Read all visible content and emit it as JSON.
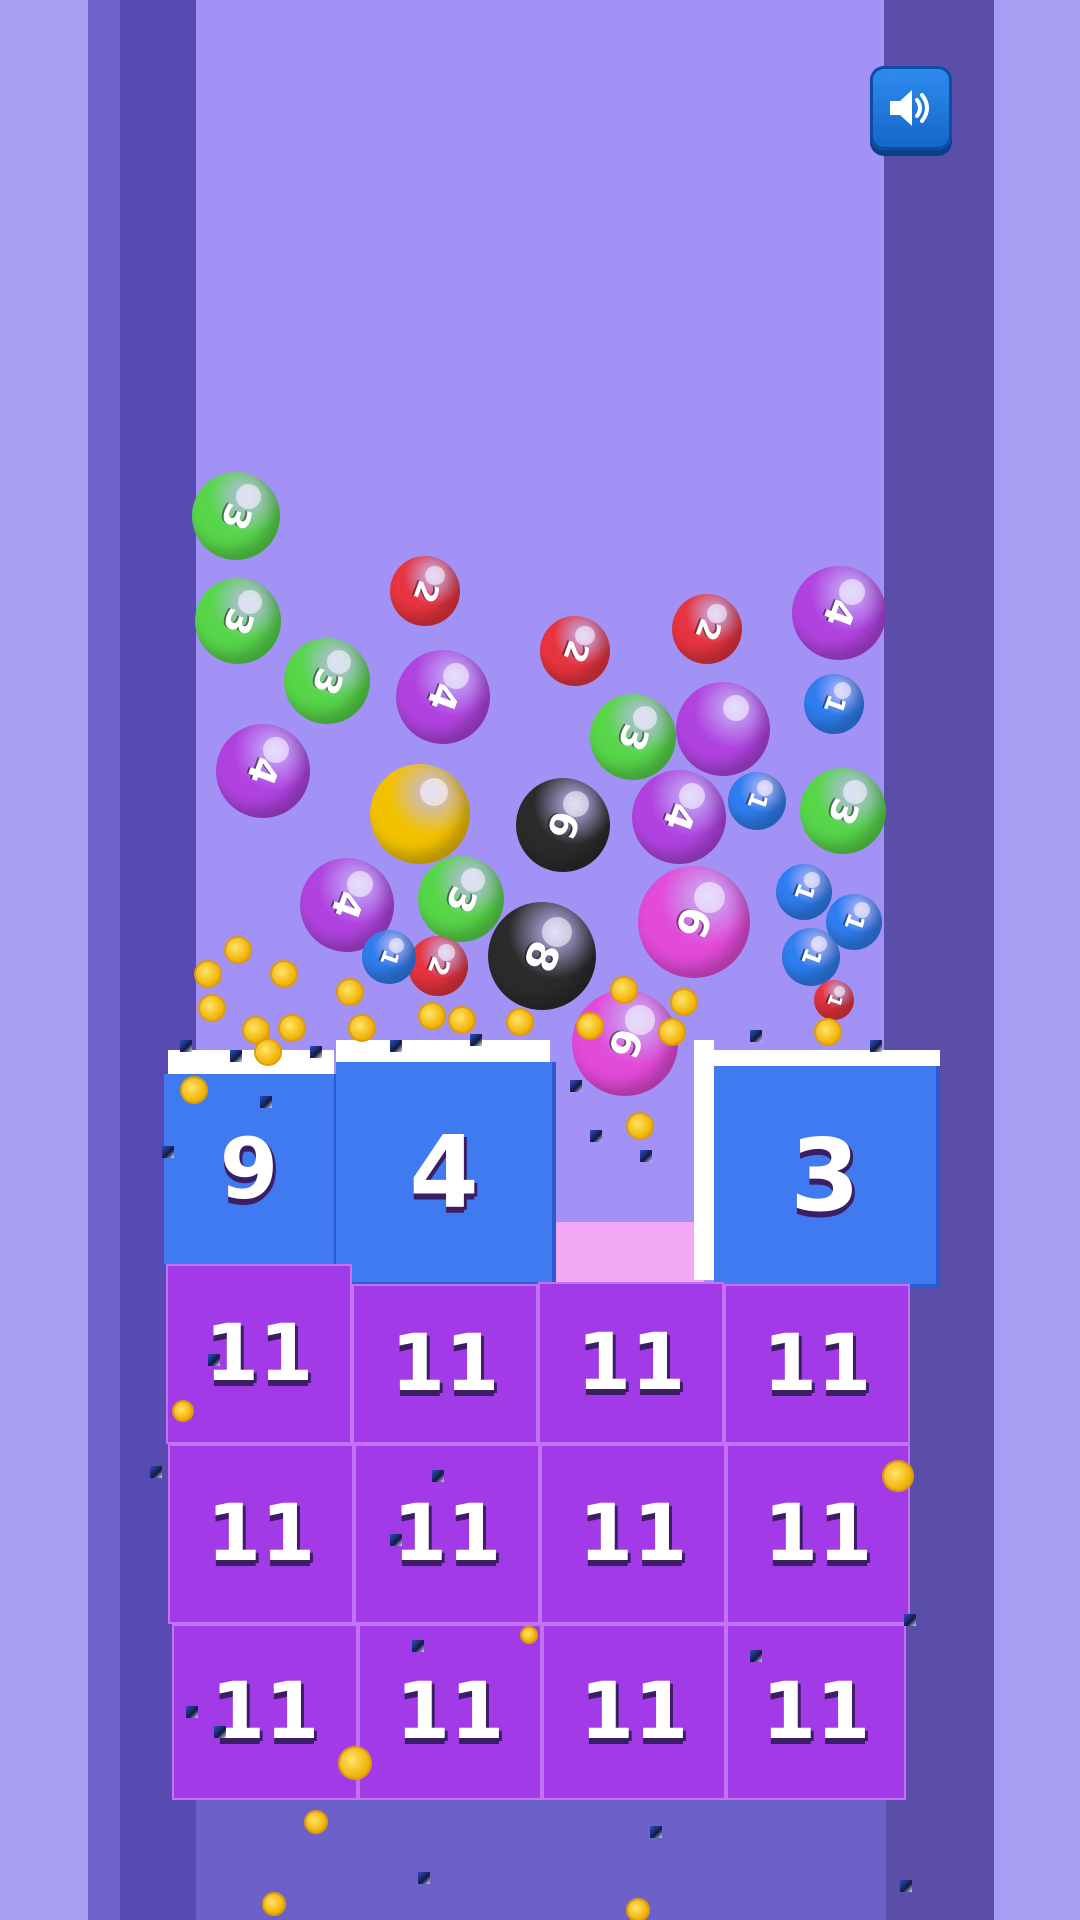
{
  "sound_button": {
    "icon": "speaker-icon",
    "color": "#1e74de"
  },
  "balls": [
    {
      "label": "3",
      "color": "#57d64a"
    },
    {
      "label": "3",
      "color": "#57d64a"
    },
    {
      "label": "3",
      "color": "#57d64a"
    },
    {
      "label": "2",
      "color": "#e8343f"
    },
    {
      "label": "2",
      "color": "#e8343f"
    },
    {
      "label": "2",
      "color": "#e8343f"
    },
    {
      "label": "4",
      "color": "#b043e0"
    },
    {
      "label": "4",
      "color": "#b043e0"
    },
    {
      "label": "4",
      "color": "#b043e0"
    },
    {
      "label": "",
      "color": "#b043e0"
    },
    {
      "label": "4",
      "color": "#b043e0"
    },
    {
      "label": "4",
      "color": "#b043e0"
    },
    {
      "label": "3",
      "color": "#57d64a"
    },
    {
      "label": "3",
      "color": "#57d64a"
    },
    {
      "label": "3",
      "color": "#57d64a"
    },
    {
      "label": "1",
      "color": "#2f7ef0"
    },
    {
      "label": "1",
      "color": "#2f7ef0"
    },
    {
      "label": "",
      "color": "#f2c200"
    },
    {
      "label": "6",
      "color": "#2b2b2b"
    },
    {
      "label": "8",
      "color": "#2b2b2b"
    },
    {
      "label": "6",
      "color": "#e24ad8"
    },
    {
      "label": "1",
      "color": "#2f7ef0"
    },
    {
      "label": "1",
      "color": "#2f7ef0"
    },
    {
      "label": "1",
      "color": "#2f7ef0"
    },
    {
      "label": "2",
      "color": "#e8343f"
    },
    {
      "label": "1",
      "color": "#2f7ef0"
    },
    {
      "label": "6",
      "color": "#e24ad8"
    },
    {
      "label": "1",
      "color": "#e8343f"
    }
  ],
  "top_blocks": [
    {
      "label": "9"
    },
    {
      "label": "4"
    },
    {
      "label": "3"
    }
  ],
  "grid_blocks": {
    "rows": [
      [
        "11",
        "11",
        "11",
        "11"
      ],
      [
        "11",
        "11",
        "11",
        "11"
      ],
      [
        "11",
        "11",
        "11",
        "11"
      ]
    ]
  }
}
